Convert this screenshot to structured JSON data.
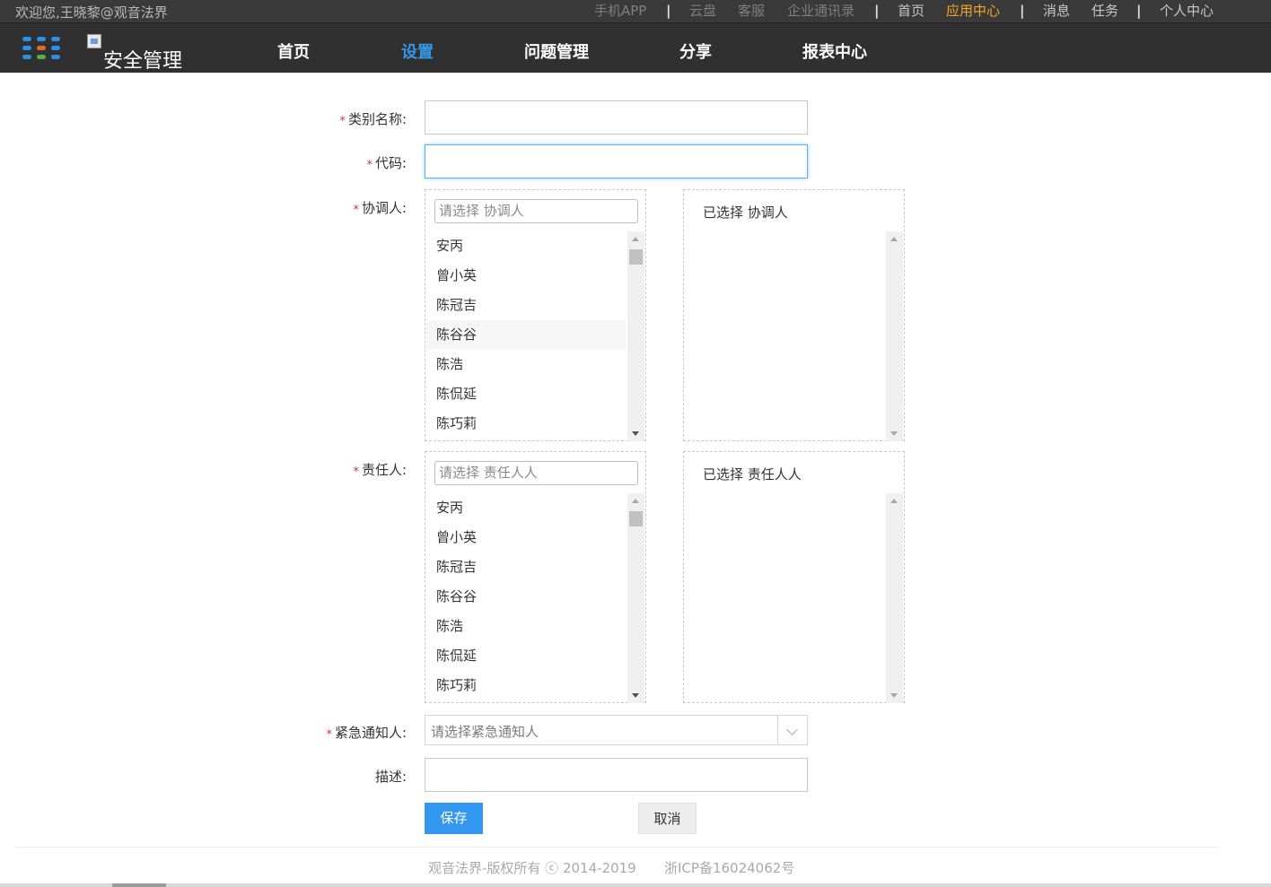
{
  "topbar": {
    "welcome": "欢迎您,王晓黎@观音法界",
    "links": {
      "mobile_app": "手机APP",
      "cloud_disk": "云盘",
      "customer_service": "客服",
      "contacts": "企业通讯录",
      "home": "首页",
      "app_center": "应用中心",
      "messages": "消息",
      "tasks": "任务",
      "personal_center": "个人中心"
    },
    "separator": "|"
  },
  "navbar": {
    "logo_alt": "安全管理",
    "items": [
      "首页",
      "设置",
      "问题管理",
      "分享",
      "报表中心"
    ],
    "active_index": 1
  },
  "form": {
    "category_name_label": "类别名称:",
    "code_label": "代码:",
    "coordinator_label": "协调人:",
    "responsible_label": "责任人:",
    "emergency_label": "紧急通知人:",
    "description_label": "描述:",
    "required_mark": "*",
    "coordinator_search_placeholder": "请选择 协调人",
    "coordinator_selected_title": "已选择 协调人",
    "responsible_search_placeholder": "请选择 责任人人",
    "responsible_selected_title": "已选择 责任人人",
    "emergency_placeholder": "请选择紧急通知人",
    "people": [
      "安丙",
      "曾小英",
      "陈冠吉",
      "陈谷谷",
      "陈浩",
      "陈侃延",
      "陈巧莉"
    ],
    "save": "保存",
    "cancel": "取消"
  },
  "footer": {
    "copyright": "观音法界-版权所有 ⓒ 2014-2019",
    "icp": "浙ICP备16024062号"
  },
  "colors": {
    "accent_blue": "#3397ef",
    "active_orange": "#f2a622",
    "required_red": "#d9343b",
    "nav_bg": "#303030"
  }
}
